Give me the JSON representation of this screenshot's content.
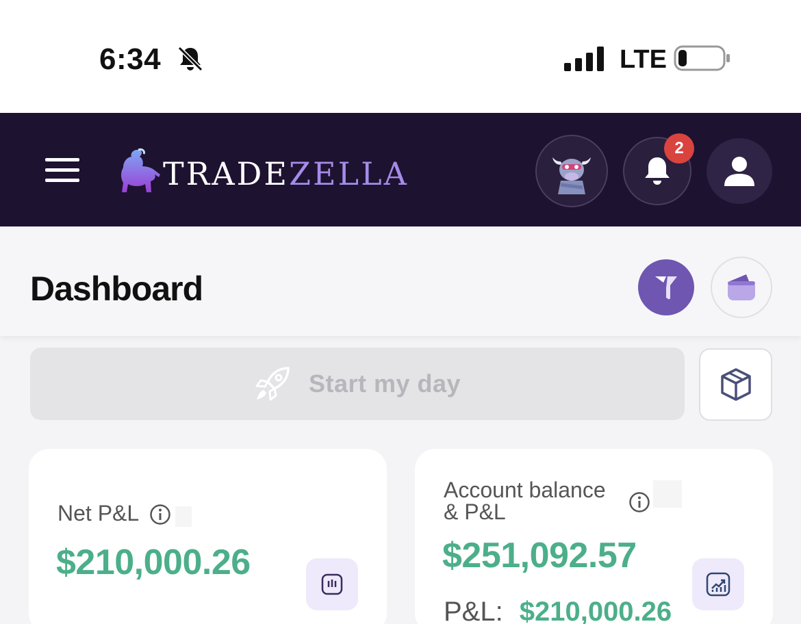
{
  "status_bar": {
    "time": "6:34",
    "network": "LTE"
  },
  "nav": {
    "brand_part1": "TRADE",
    "brand_part2": "ZELLA",
    "notification_count": "2"
  },
  "dashboard": {
    "title": "Dashboard",
    "start_my_day": "Start my day"
  },
  "cards": {
    "net_pnl": {
      "label": "Net P&L",
      "value": "$210,000.26"
    },
    "account_balance": {
      "label_line1": "Account balance",
      "label_line2": "& P&L",
      "value": "$251,092.57",
      "pnl_label": "P&L:",
      "pnl_value": "$210,000.26"
    }
  },
  "colors": {
    "nav_bg": "#1d1230",
    "accent_purple": "#6f56b1",
    "positive_green": "#4caf8a",
    "badge_red": "#d9443f"
  }
}
